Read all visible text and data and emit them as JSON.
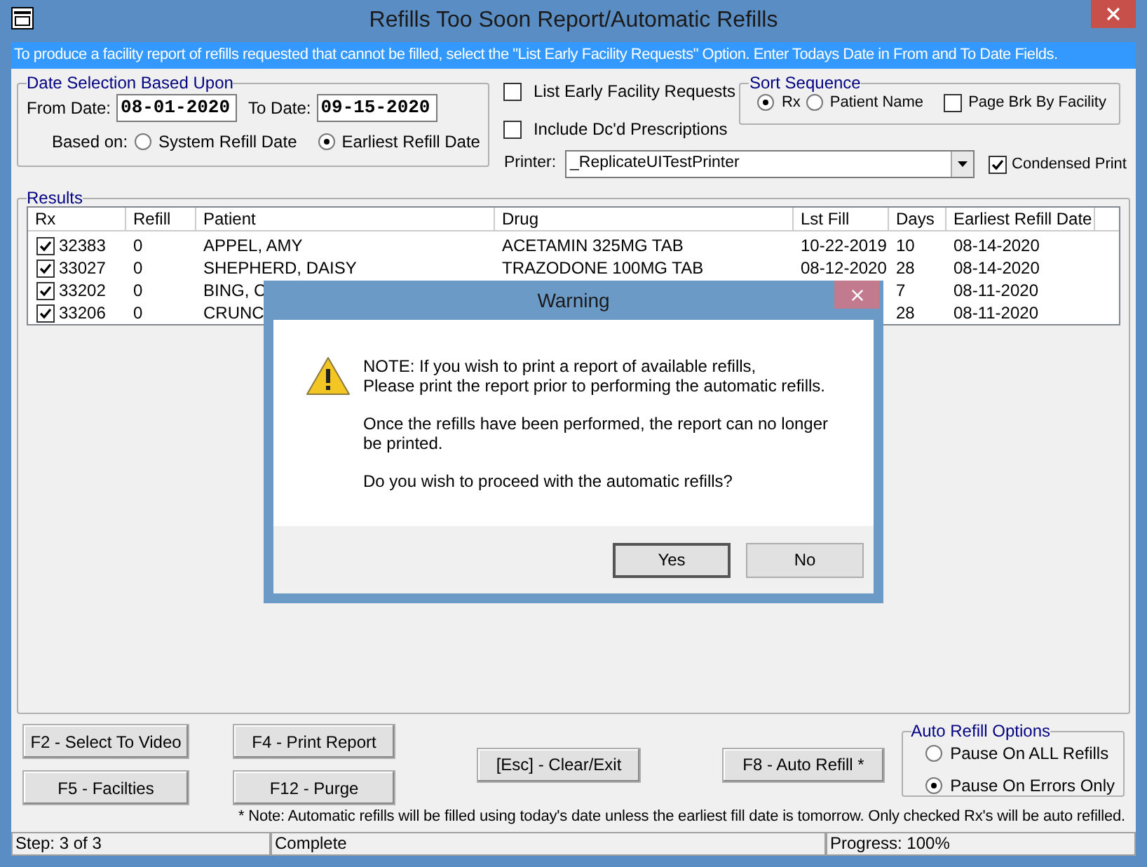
{
  "window": {
    "title": "Refills Too Soon Report/Automatic Refills"
  },
  "info_banner": "To produce a facility report of refills requested that cannot be filled, select the \"List Early Facility Requests\" Option. Enter Todays Date in From and To Date Fields.",
  "date_selection": {
    "title": "Date Selection Based Upon",
    "from_label": "From Date:",
    "from_value": "08-01-2020",
    "to_label": "To Date:",
    "to_value": "09-15-2020",
    "based_on_label": "Based on:",
    "options": [
      {
        "label": "System Refill Date",
        "selected": false
      },
      {
        "label": "Earliest Refill Date",
        "selected": true
      }
    ]
  },
  "filters": [
    {
      "label": "List Early Facility Requests",
      "checked": false
    },
    {
      "label": "Include Dc'd Prescriptions",
      "checked": false
    }
  ],
  "sort_sequence": {
    "title": "Sort Sequence",
    "options": [
      {
        "label": "Rx",
        "selected": true
      },
      {
        "label": "Patient Name",
        "selected": false
      }
    ],
    "page_break": {
      "label": "Page Brk By Facility",
      "checked": false
    }
  },
  "printer": {
    "label": "Printer:",
    "value": "_ReplicateUITestPrinter"
  },
  "condensed_print": {
    "label": "Condensed Print",
    "checked": true
  },
  "results": {
    "title": "Results",
    "columns": [
      "Rx",
      "Refill",
      "Patient",
      "Drug",
      "Lst Fill",
      "Days",
      "Earliest Refill Date"
    ],
    "rows": [
      {
        "checked": true,
        "cells": [
          "32383",
          "0",
          "APPEL, AMY",
          "ACETAMIN 325MG TAB",
          "10-22-2019",
          "10",
          "08-14-2020"
        ]
      },
      {
        "checked": true,
        "cells": [
          "33027",
          "0",
          "SHEPHERD, DAISY",
          "TRAZODONE 100MG TAB",
          "08-12-2020",
          "28",
          "08-14-2020"
        ]
      },
      {
        "checked": true,
        "cells": [
          "33202",
          "0",
          "BING, C",
          "",
          "",
          "7",
          "08-11-2020"
        ]
      },
      {
        "checked": true,
        "cells": [
          "33206",
          "0",
          "CRUNC",
          "",
          "",
          "28",
          "08-11-2020"
        ]
      }
    ]
  },
  "button_columns": [
    [
      "F2 - Select To Video",
      "F5 - Facilties"
    ],
    [
      "F4 - Print Report",
      "F12 - Purge"
    ],
    [
      "[Esc] - Clear/Exit"
    ],
    [
      "F8 - Auto Refill *"
    ]
  ],
  "auto_refill_options": {
    "title": "Auto Refill Options",
    "options": [
      {
        "label": "Pause On ALL Refills",
        "selected": false
      },
      {
        "label": "Pause On Errors Only",
        "selected": true
      }
    ]
  },
  "note": "* Note: Automatic refills will be filled using today's date unless the earliest fill date is tomorrow. Only checked Rx's will be auto refilled.",
  "status_bar": [
    "Step: 3 of 3",
    "Complete",
    "Progress: 100%"
  ],
  "dialog": {
    "title": "Warning",
    "paragraphs": [
      "NOTE:  If you wish to print a report of available refills,\nPlease print the report prior to performing the automatic refills.",
      "Once the refills have been performed, the report can no longer be printed.",
      "Do you wish to proceed with the automatic refills?"
    ],
    "buttons": [
      "Yes",
      "No"
    ]
  }
}
